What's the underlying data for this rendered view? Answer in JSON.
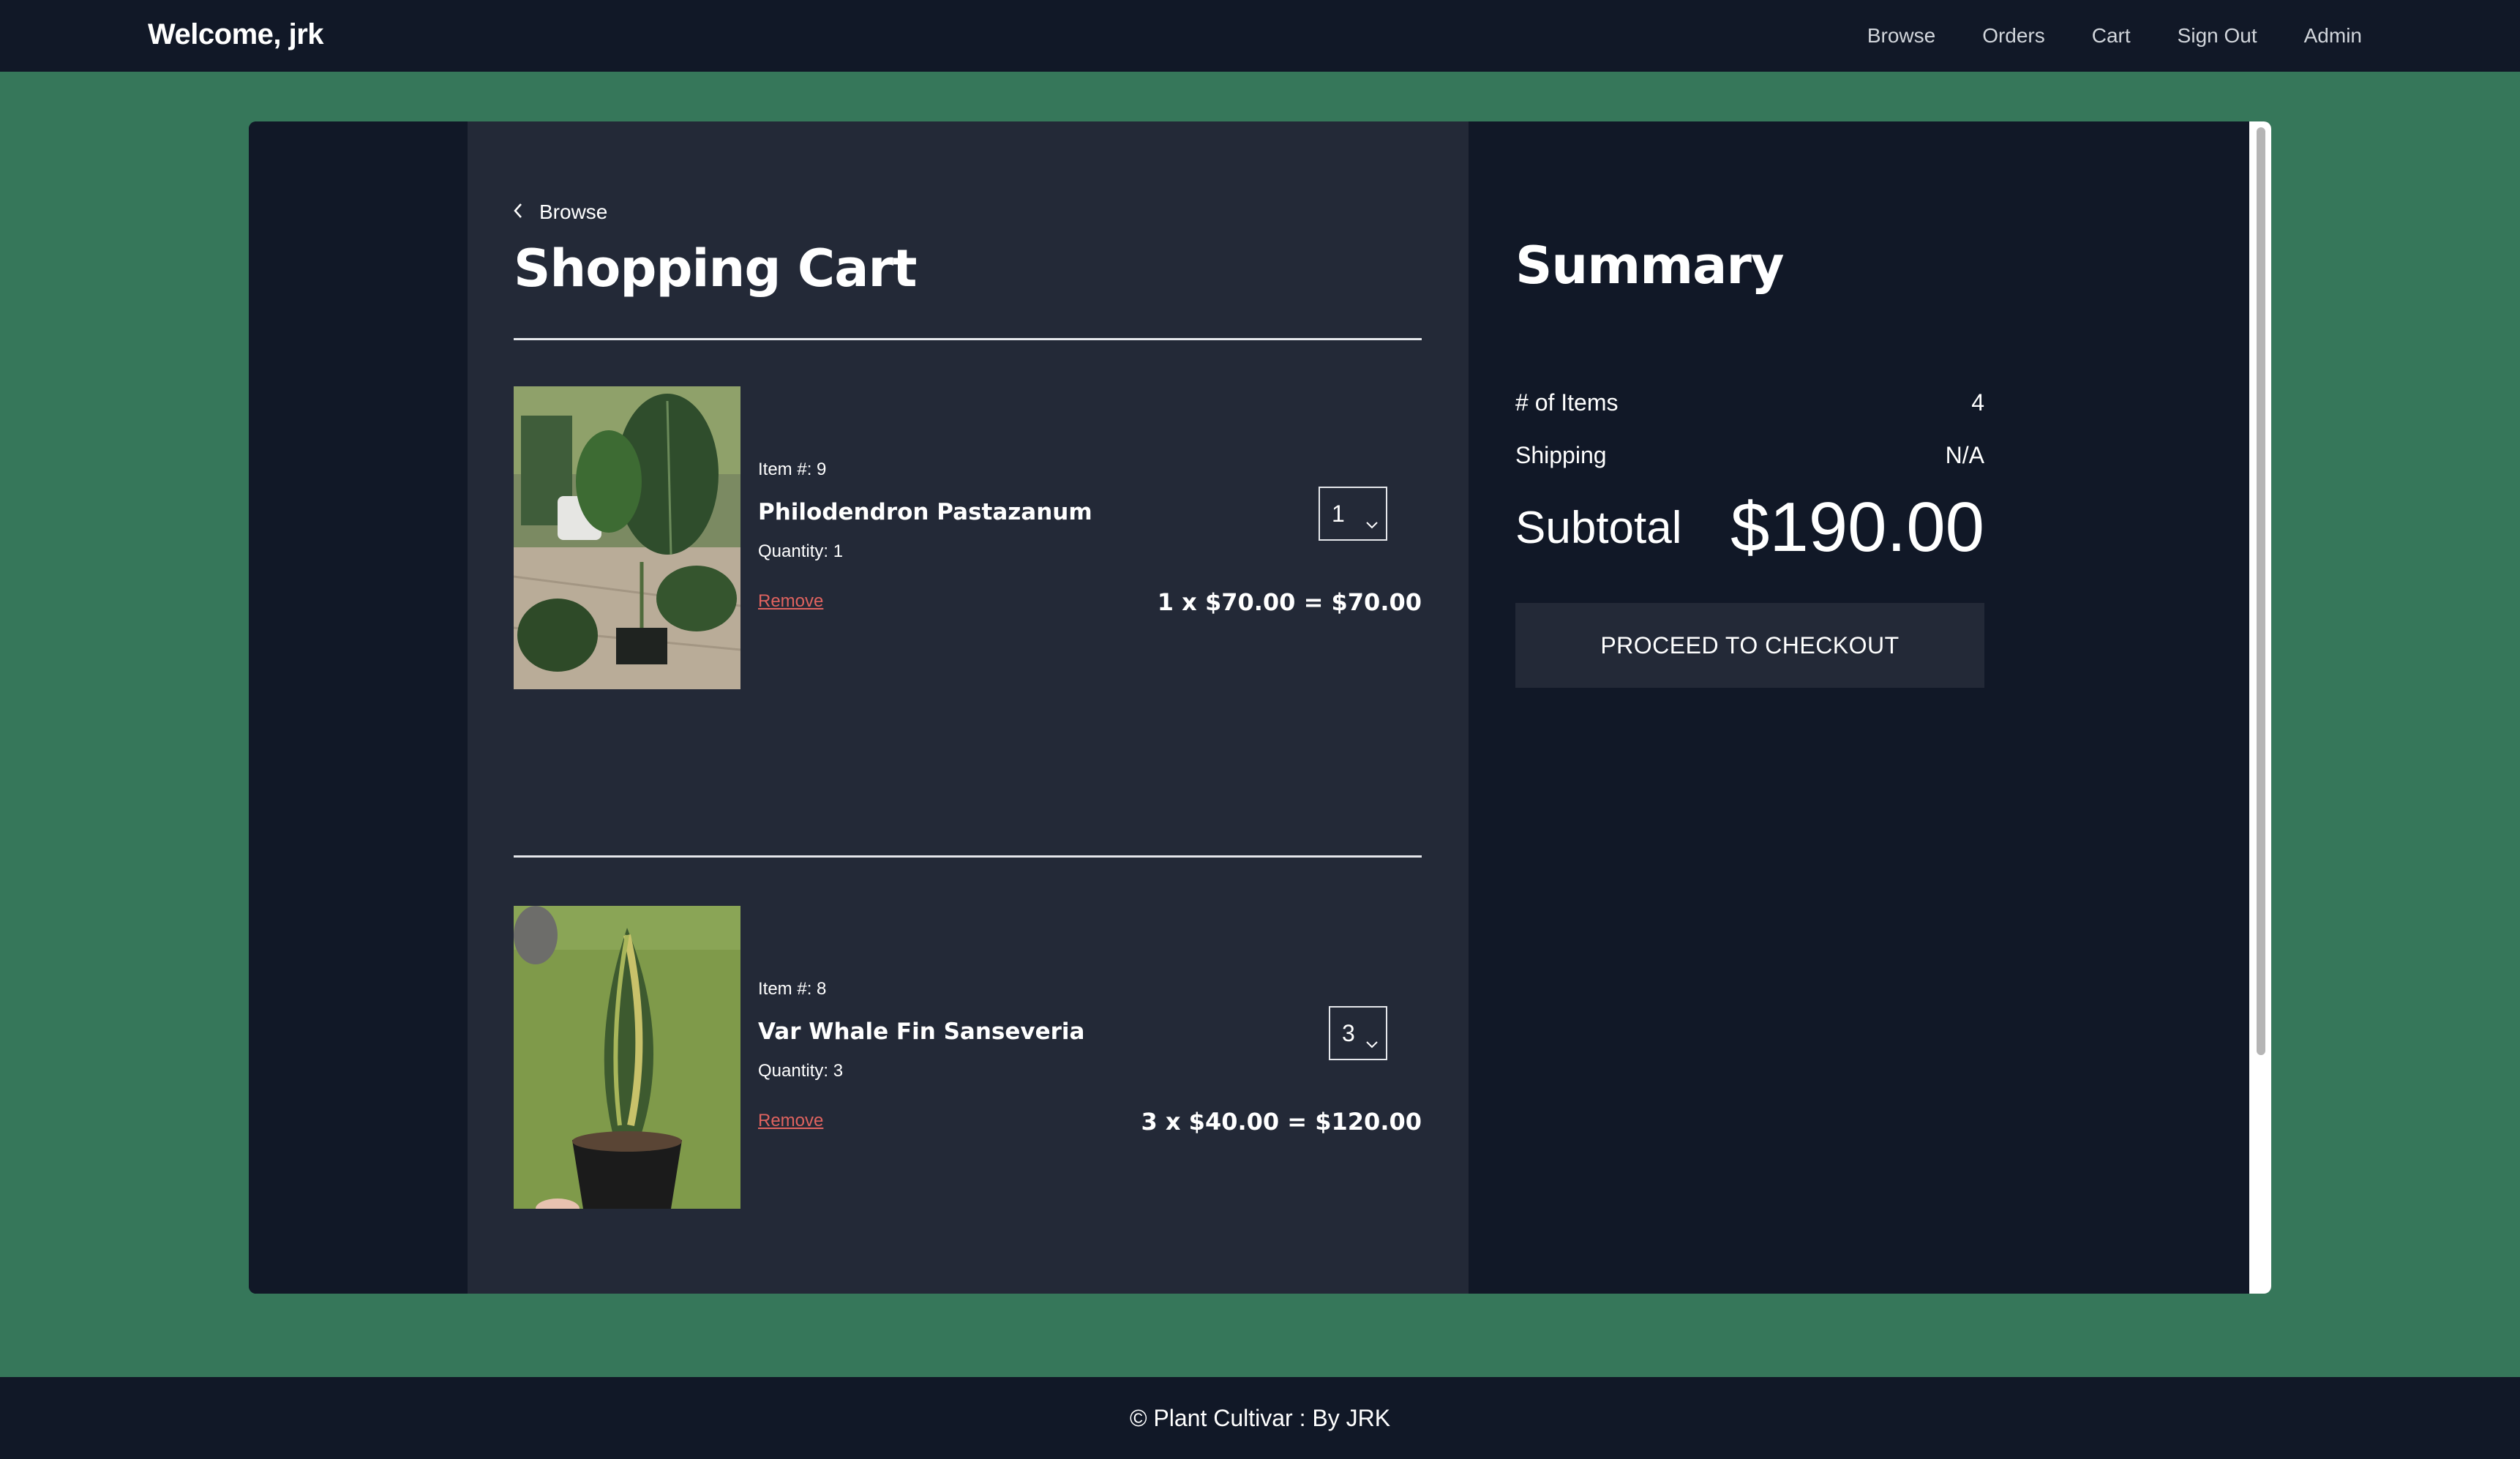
{
  "navbar": {
    "brand": "Welcome, jrk",
    "links": [
      "Browse",
      "Orders",
      "Cart",
      "Sign Out",
      "Admin"
    ]
  },
  "cart": {
    "back_label": "Browse",
    "title": "Shopping Cart",
    "items": [
      {
        "item_no": "Item #: 9",
        "name": "Philodendron Pastazanum",
        "quantity_text": "Quantity: 1",
        "remove_label": "Remove",
        "select_value": "1",
        "line_total": "1 x $70.00 = $70.00"
      },
      {
        "item_no": "Item #: 8",
        "name": "Var Whale Fin Sanseveria",
        "quantity_text": "Quantity: 3",
        "remove_label": "Remove",
        "select_value": "3",
        "line_total": "3 x $40.00 = $120.00"
      }
    ]
  },
  "summary": {
    "title": "Summary",
    "items_label": "# of Items",
    "items_value": "4",
    "shipping_label": "Shipping",
    "shipping_value": "N/A",
    "subtotal_label": "Subtotal",
    "subtotal_value": "$190.00",
    "checkout_label": "PROCEED TO CHECKOUT"
  },
  "footer": {
    "text": "© Plant Cultivar : By JRK"
  },
  "colors": {
    "page_bg": "#36775a",
    "navbar_bg": "#111827",
    "cart_bg": "#232937",
    "remove_link": "#e0635f"
  }
}
